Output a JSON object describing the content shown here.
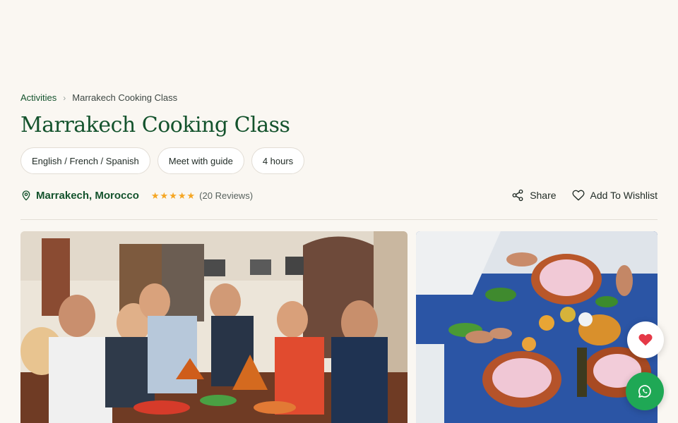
{
  "breadcrumb": {
    "root": "Activities",
    "separator": "›",
    "current": "Marrakech Cooking Class"
  },
  "page": {
    "title": "Marrakech Cooking Class"
  },
  "chips": [
    "English / French / Spanish",
    "Meet with guide",
    "4 hours"
  ],
  "location": {
    "label": "Marrakech, Morocco",
    "icon": "map-pin-icon"
  },
  "rating": {
    "stars": 5,
    "star_glyph": "★",
    "reviews_label": "(20 Reviews)"
  },
  "actions": {
    "share_label": "Share",
    "wishlist_label": "Add To Wishlist"
  },
  "gallery": {
    "main_photo": "cooking-class-group-photo",
    "side_photo": "tagine-table-photo"
  },
  "colors": {
    "brand_green": "#14532d",
    "star": "#f5a623",
    "whatsapp": "#1fa855",
    "heart": "#e53947"
  }
}
